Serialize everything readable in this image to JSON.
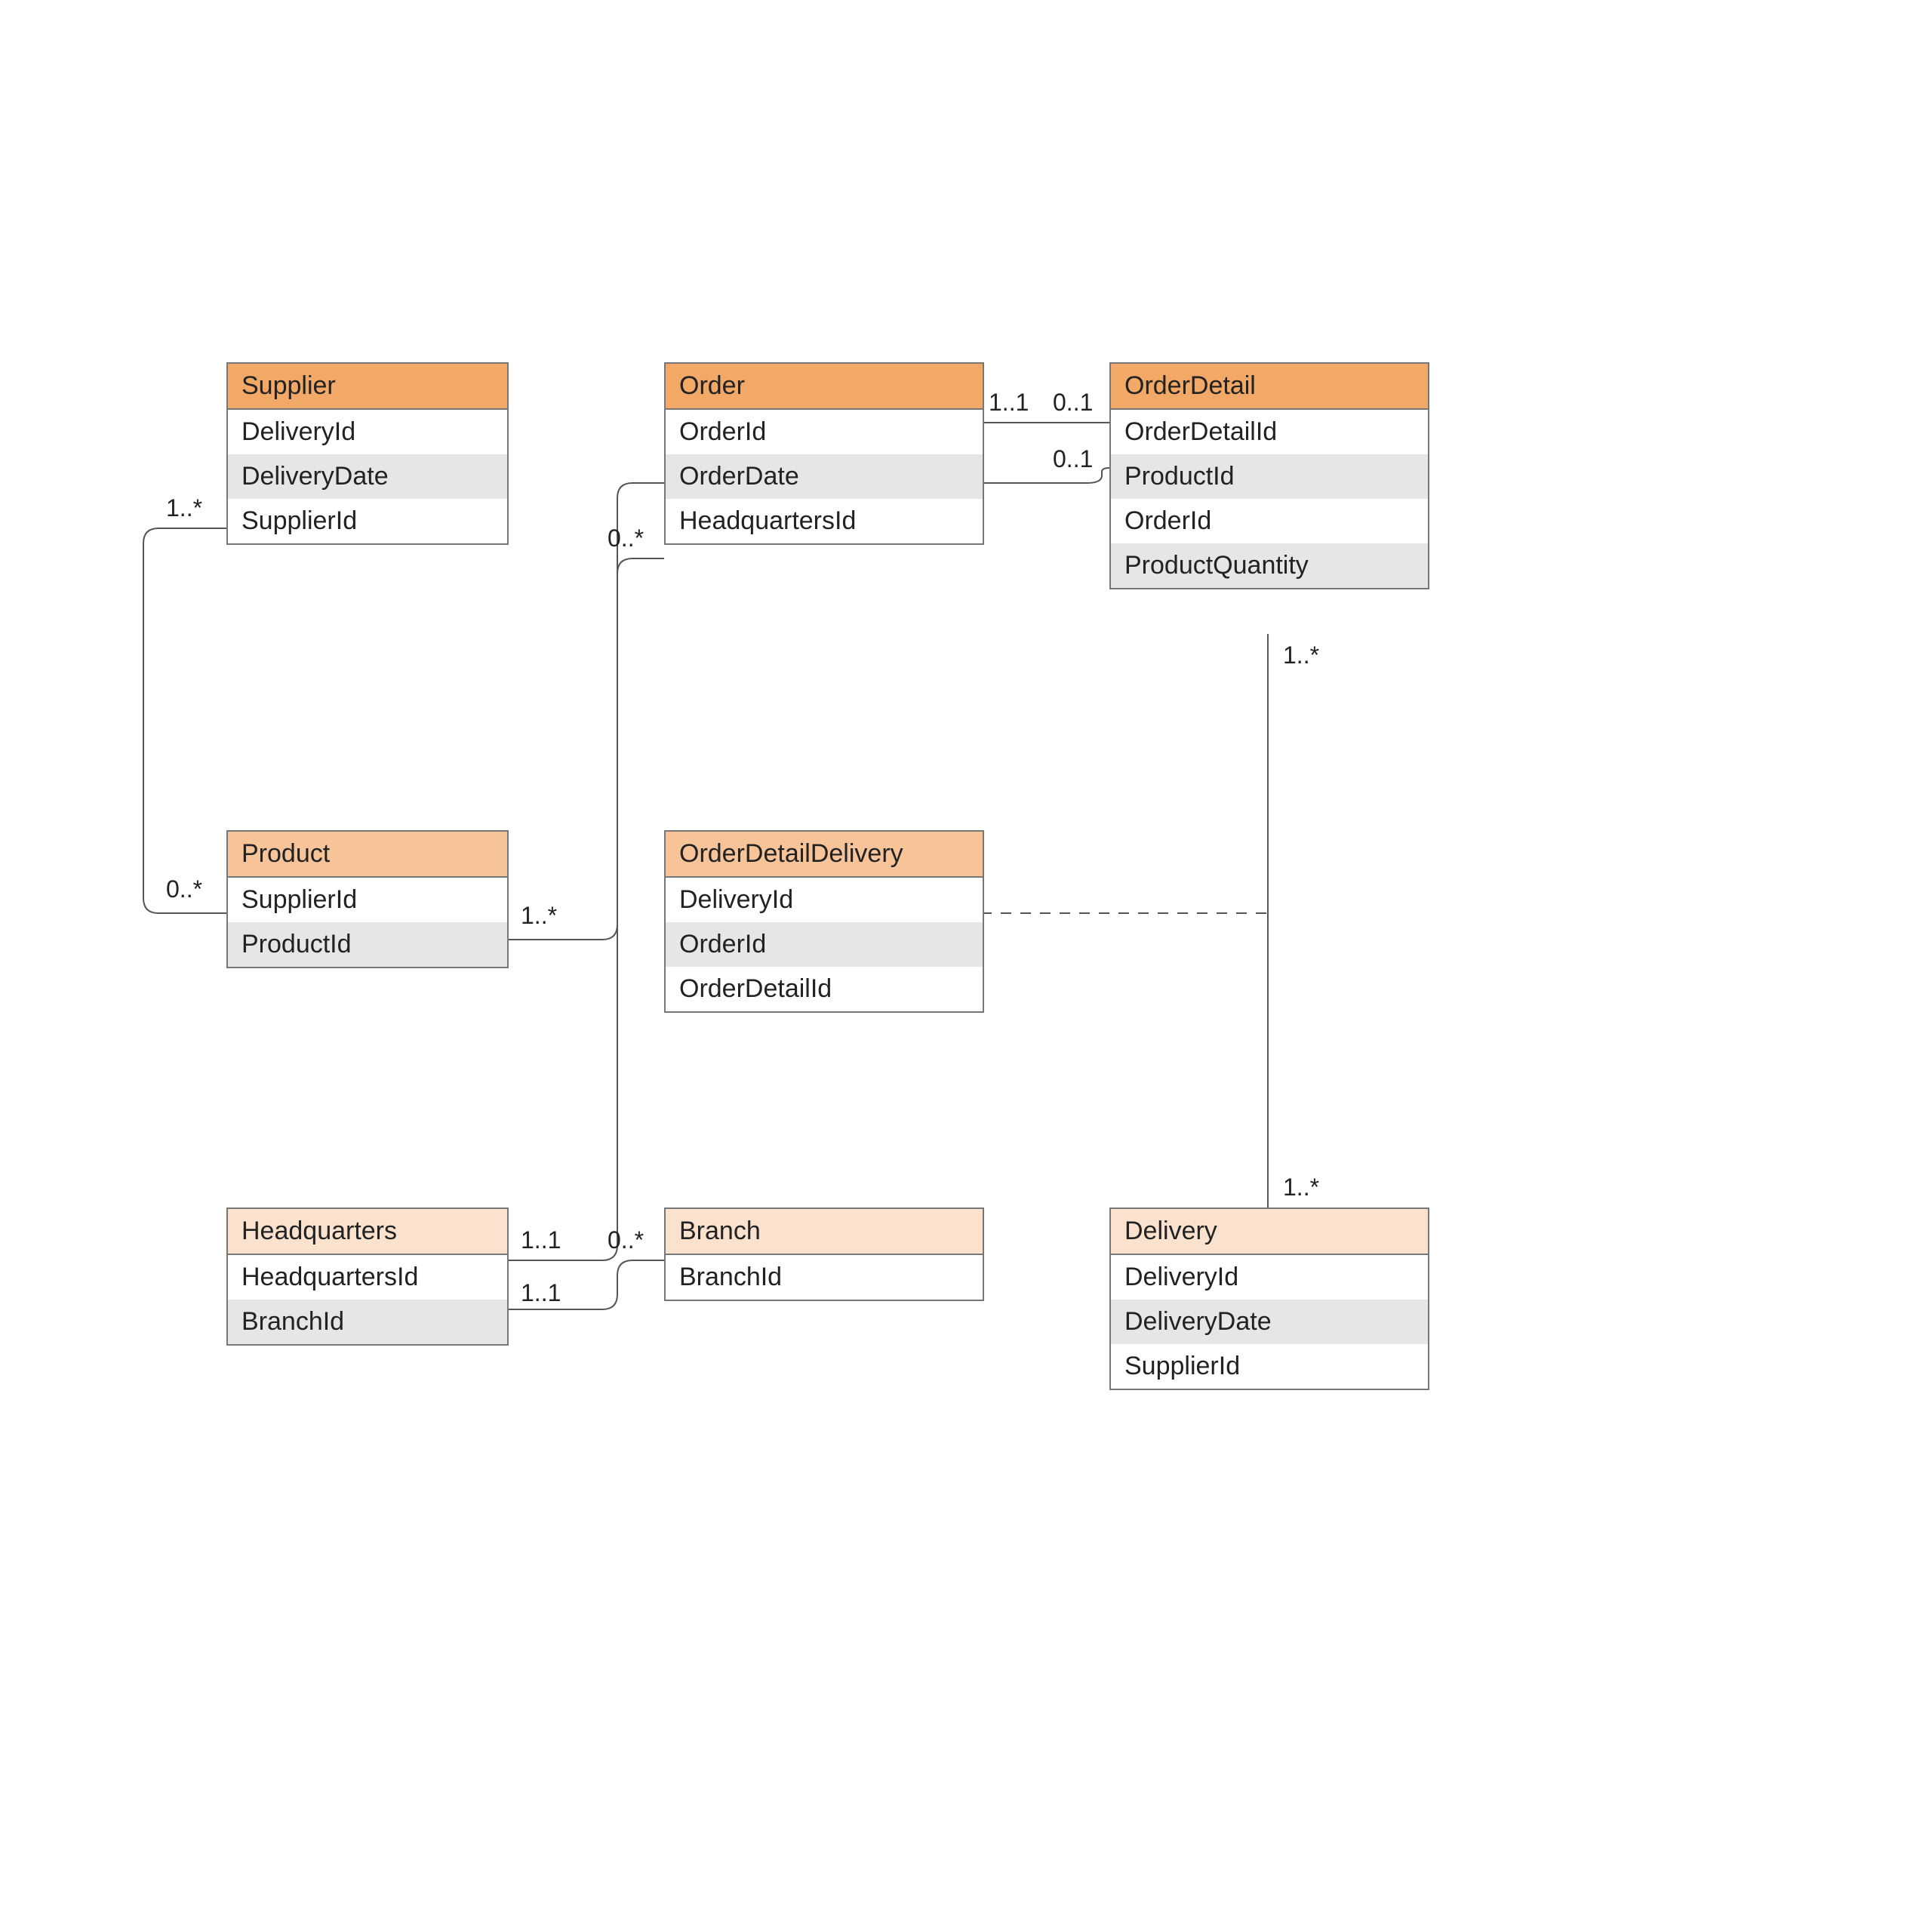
{
  "entities": {
    "supplier": {
      "title": "Supplier",
      "attrs": [
        "DeliveryId",
        "DeliveryDate",
        "SupplierId"
      ]
    },
    "product": {
      "title": "Product",
      "attrs": [
        "SupplierId",
        "ProductId"
      ]
    },
    "headquarters": {
      "title": "Headquarters",
      "attrs": [
        "HeadquartersId",
        "BranchId"
      ]
    },
    "order": {
      "title": "Order",
      "attrs": [
        "OrderId",
        "OrderDate",
        "HeadquartersId"
      ]
    },
    "orderDetail": {
      "title": "OrderDetail",
      "attrs": [
        "OrderDetailId",
        "ProductId",
        "OrderId",
        "ProductQuantity"
      ]
    },
    "orderDetailDelivery": {
      "title": "OrderDetailDelivery",
      "attrs": [
        "DeliveryId",
        "OrderId",
        "OrderDetailId"
      ]
    },
    "branch": {
      "title": "Branch",
      "attrs": [
        "BranchId"
      ]
    },
    "delivery": {
      "title": "Delivery",
      "attrs": [
        "DeliveryId",
        "DeliveryDate",
        "SupplierId"
      ]
    }
  },
  "mult": {
    "sup_prod_top": "1..*",
    "sup_prod_bot": "0..*",
    "order_left": "0..*",
    "prod_right": "1..*",
    "hq_right_top": "1..1",
    "hq_right_bot": "1..1",
    "branch_left": "0..*",
    "order_od_left": "1..1",
    "order_od_right": "0..1",
    "prod_od": "0..1",
    "od_deliv_top": "1..*",
    "od_deliv_bot": "1..*"
  }
}
